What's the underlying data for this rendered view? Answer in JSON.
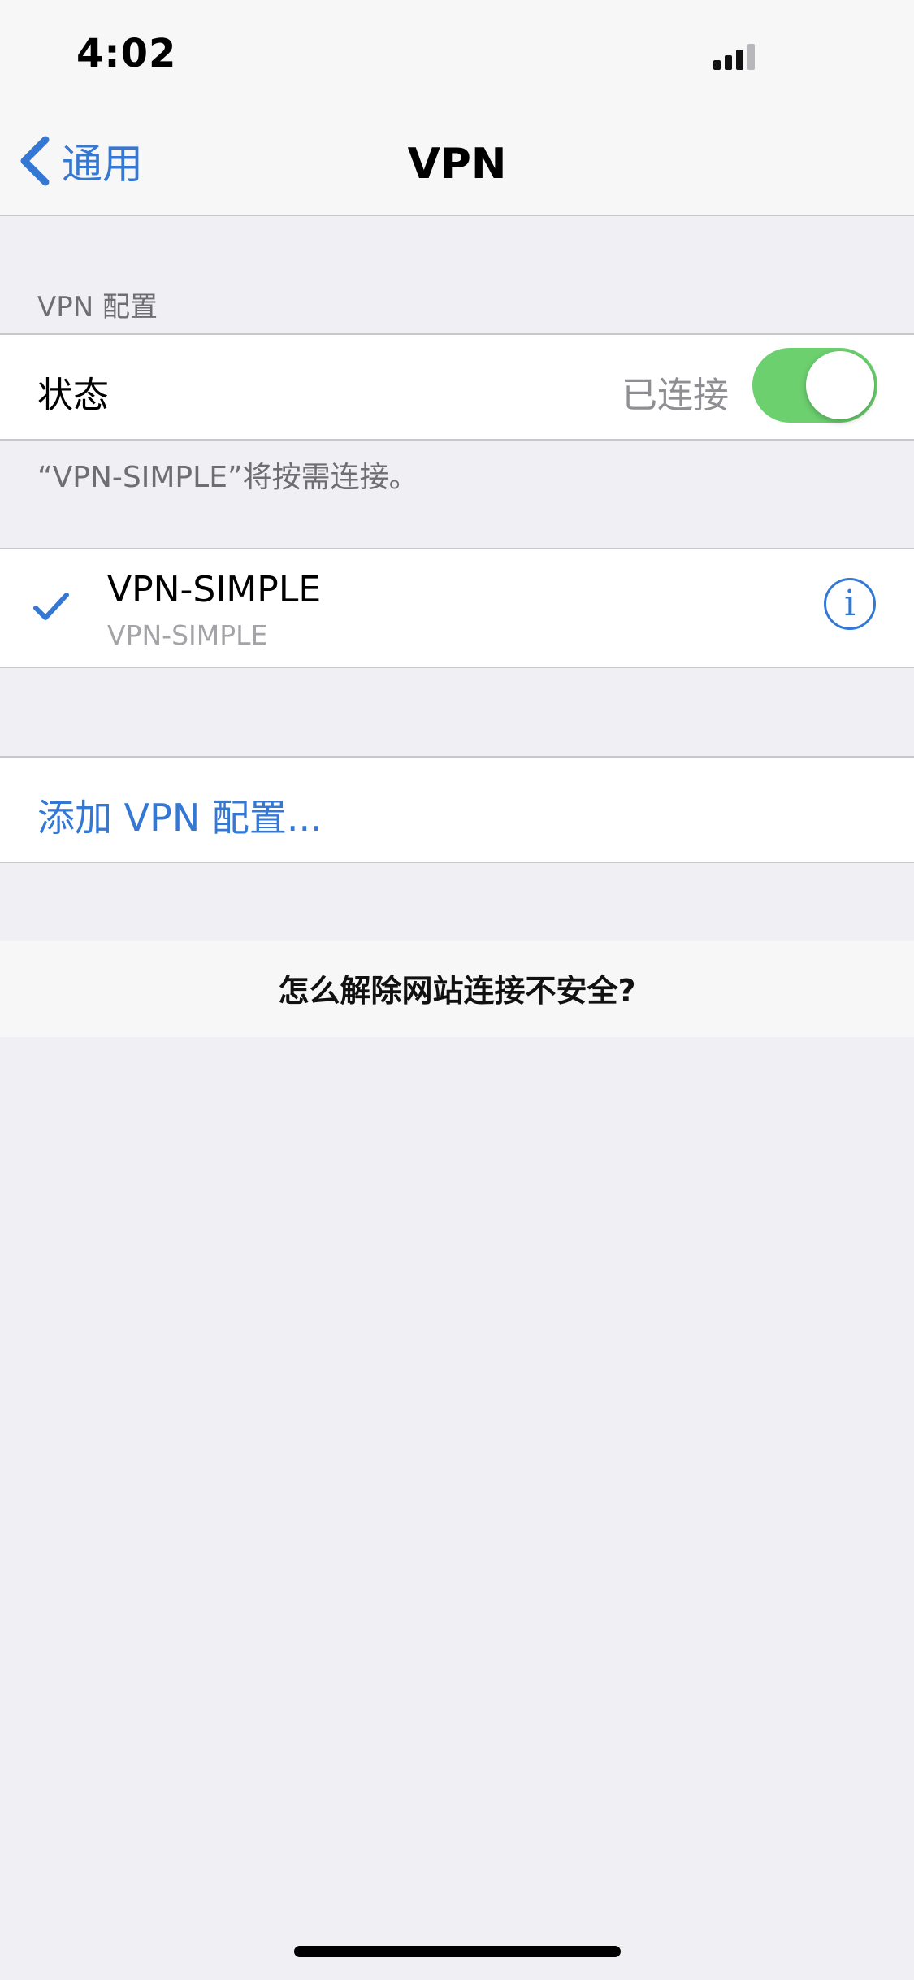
{
  "status_bar": {
    "time": "4:02",
    "signal_icon": "cellular-signal-icon"
  },
  "nav": {
    "back_label": "通用",
    "back_icon": "chevron-left-icon",
    "title": "VPN"
  },
  "vpn_config": {
    "section_header": "VPN 配置",
    "status_label": "状态",
    "status_value": "已连接",
    "toggle_on": true,
    "footer": "“VPN-SIMPLE”将按需连接。"
  },
  "profile": {
    "name": "VPN-SIMPLE",
    "subtitle": "VPN-SIMPLE",
    "selected": true,
    "info_glyph": "i",
    "info_icon": "info-icon"
  },
  "add_config": {
    "label": "添加 VPN 配置..."
  },
  "banner": {
    "text": "怎么解除网站连接不安全?"
  },
  "colors": {
    "accent": "#3478d4",
    "toggle_on": "#6cd06f",
    "background": "#efeff4"
  }
}
